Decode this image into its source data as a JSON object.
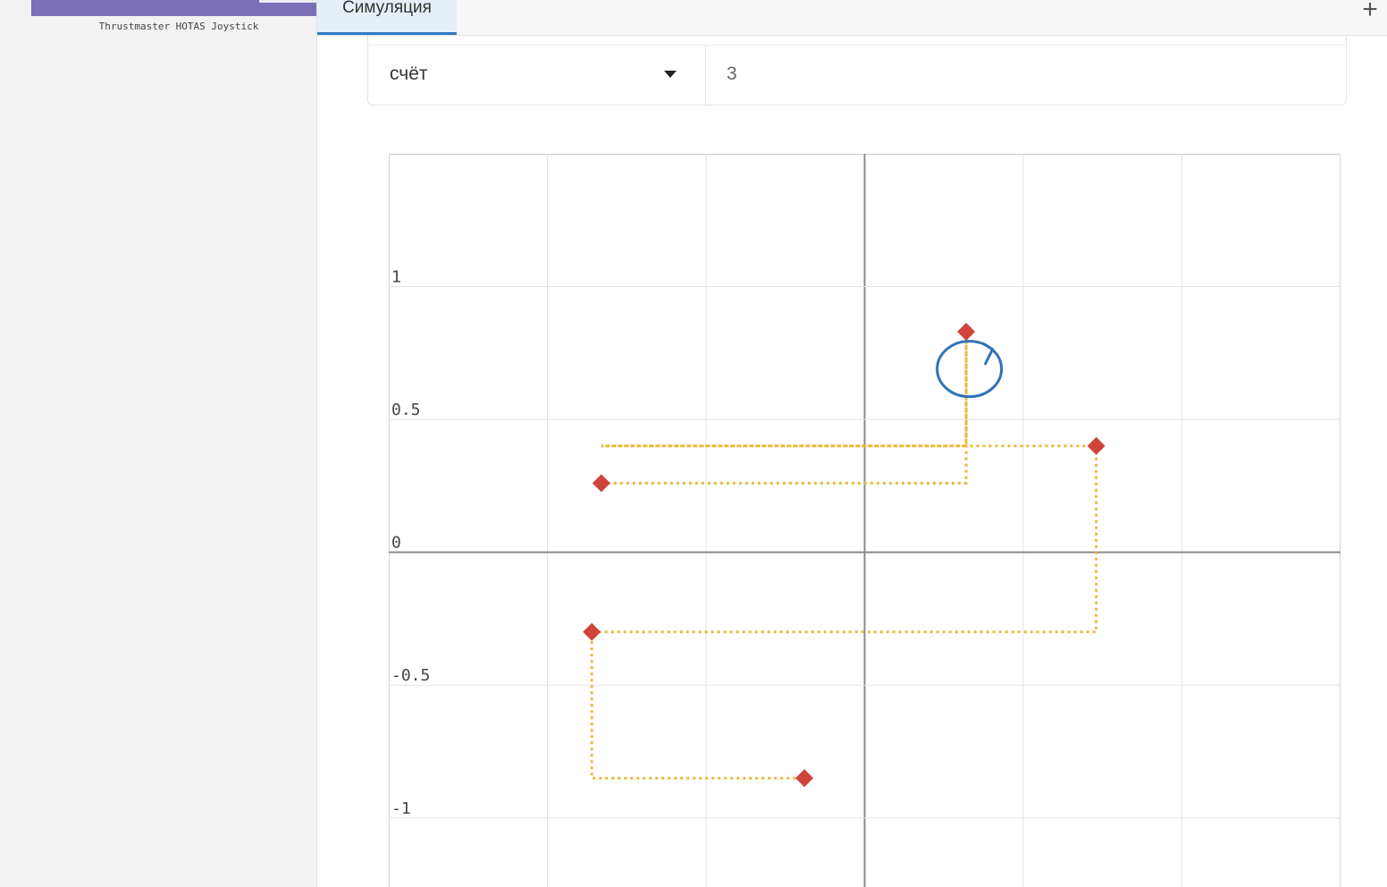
{
  "sidebar": {
    "device_caption": "Thrustmaster HOTAS Joystick"
  },
  "tabs": [
    {
      "label": "Симуляция",
      "active": true
    }
  ],
  "add_tab_label": "+",
  "score": {
    "selector_label": "счёт",
    "value": "3"
  },
  "colors": {
    "accent": "#2e7ac7",
    "device_image": "#7b6fb8",
    "path": "#e8b83a",
    "marker": "#d0433b",
    "cursor_circle": "#2f74b8"
  },
  "chart_data": {
    "type": "scatter",
    "title": "",
    "xlabel": "",
    "ylabel": "",
    "xlim": [
      -1.5,
      1.5
    ],
    "ylim": [
      -1.26,
      1.5
    ],
    "grid": true,
    "x_gridlines": [
      -1.5,
      -1,
      -0.5,
      0,
      0.5,
      1,
      1.5
    ],
    "y_gridlines": [
      -1,
      -0.5,
      0,
      0.5,
      1
    ],
    "y_tick_labels": [
      {
        "value": 1,
        "label": "1"
      },
      {
        "value": 0.5,
        "label": "0.5"
      },
      {
        "value": 0,
        "label": "0"
      },
      {
        "value": -0.5,
        "label": "-0.5"
      },
      {
        "value": -1,
        "label": "-1"
      }
    ],
    "points": [
      {
        "x": -0.83,
        "y": 0.26
      },
      {
        "x": 0.32,
        "y": 0.83
      },
      {
        "x": 0.73,
        "y": 0.4
      },
      {
        "x": -0.86,
        "y": -0.3
      },
      {
        "x": -0.19,
        "y": -0.85
      }
    ],
    "path": [
      {
        "x": -0.83,
        "y": 0.26
      },
      {
        "x": 0.32,
        "y": 0.26
      },
      {
        "x": 0.32,
        "y": 0.83
      },
      {
        "x": 0.32,
        "y": 0.4
      },
      {
        "x": -0.83,
        "y": 0.4
      },
      {
        "x": 0.73,
        "y": 0.4
      },
      {
        "x": 0.73,
        "y": -0.3
      },
      {
        "x": -0.86,
        "y": -0.3
      },
      {
        "x": -0.86,
        "y": -0.85
      },
      {
        "x": -0.19,
        "y": -0.85
      }
    ],
    "cursor": {
      "x": 0.33,
      "y": 0.69
    }
  }
}
